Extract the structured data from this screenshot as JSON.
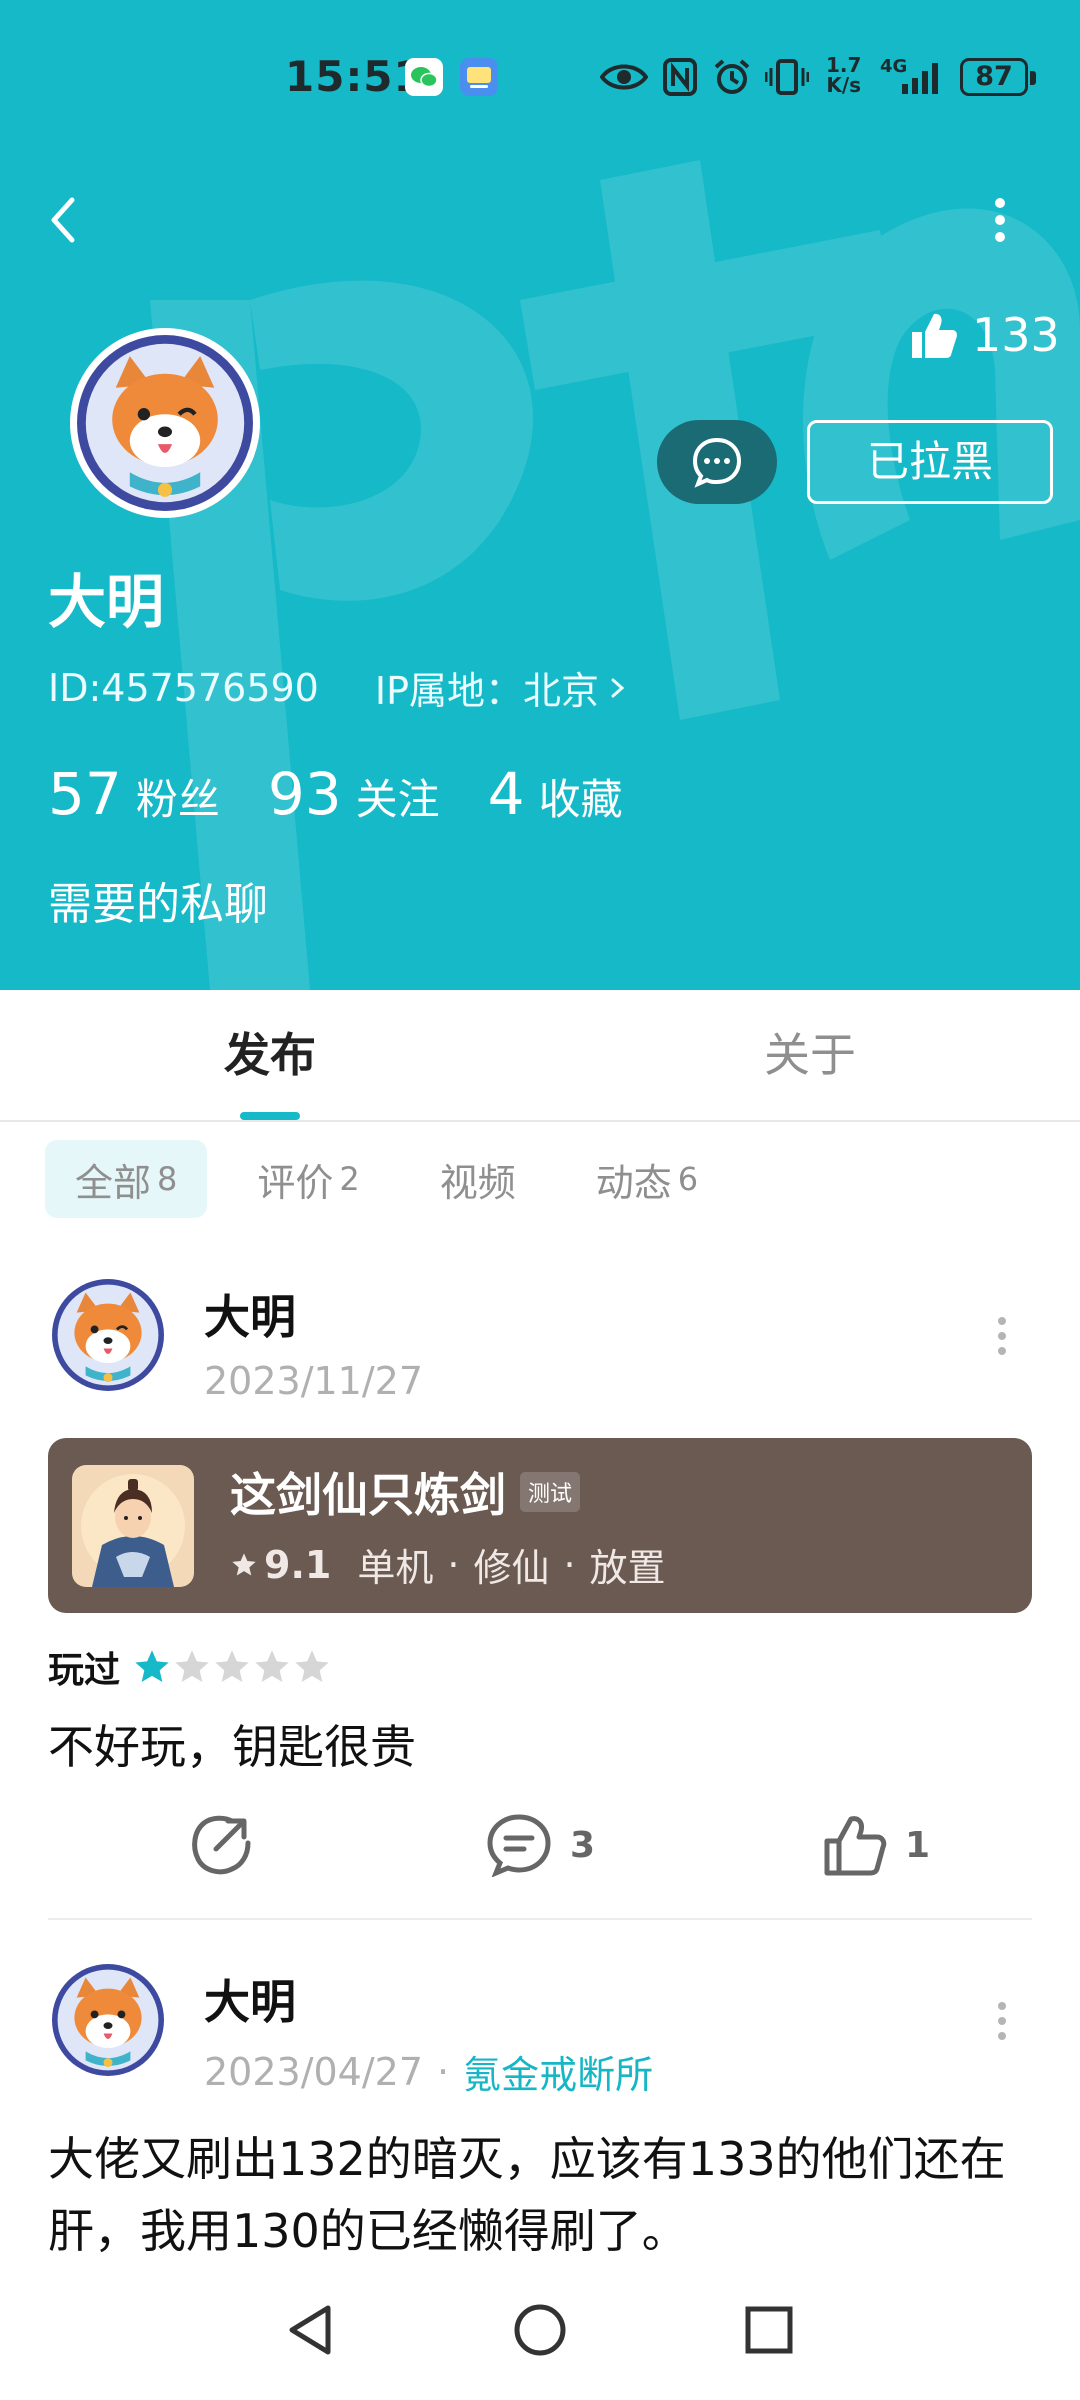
{
  "status_bar": {
    "time": "15:51",
    "net_speed_value": "1.7",
    "net_speed_unit": "K/s",
    "network": "4G",
    "battery": "87"
  },
  "header": {
    "likes_count": "133",
    "blocked_label": "已拉黑",
    "name": "大明",
    "user_id": "ID:457576590",
    "ip_location": "IP属地：北京",
    "stats": [
      {
        "value": "57",
        "label": "粉丝"
      },
      {
        "value": "93",
        "label": "关注"
      },
      {
        "value": "4",
        "label": "收藏"
      }
    ],
    "bio": "需要的私聊",
    "bg_color": "#15b9c8"
  },
  "tabs": [
    {
      "label": "发布",
      "active": true
    },
    {
      "label": "关于",
      "active": false
    }
  ],
  "filters": [
    {
      "label": "全部",
      "count": "8",
      "active": true
    },
    {
      "label": "评价",
      "count": "2",
      "active": false
    },
    {
      "label": "视频",
      "count": "",
      "active": false
    },
    {
      "label": "动态",
      "count": "6",
      "active": false
    }
  ],
  "posts": [
    {
      "author": "大明",
      "date": "2023/11/27",
      "game": {
        "title": "这剑仙只炼剑",
        "tag": "测试",
        "rating": "9.1",
        "genres": [
          "单机",
          "修仙",
          "放置"
        ]
      },
      "played_label": "玩过",
      "star_rating": 1,
      "star_max": 5,
      "text": "不好玩，钥匙很贵",
      "comments": "3",
      "likes": "1"
    },
    {
      "author": "大明",
      "date": "2023/04/27",
      "group": "氪金戒断所",
      "text": "大佬又刷出132的暗灭，应该有133的他们还在肝，我用130的已经懒得刷了。"
    }
  ],
  "colors": {
    "accent": "#15b9c8",
    "game_card": "#6a5a52",
    "star_active": "#15b9c8",
    "star_inactive": "#d6d6d6"
  }
}
